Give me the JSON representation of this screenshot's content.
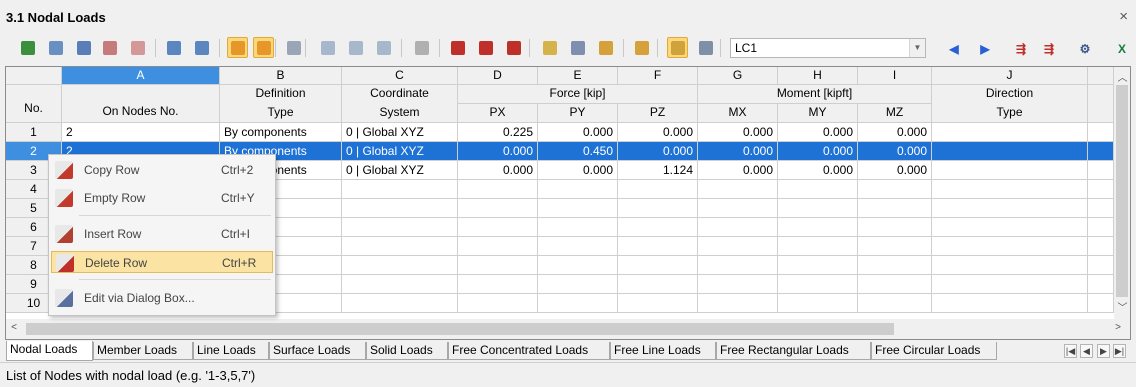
{
  "window": {
    "title": "3.1 Nodal Loads",
    "close_glyph": "×"
  },
  "toolbar": {
    "buttons": [
      {
        "name": "select-icon",
        "color": "#3c8f3c"
      },
      {
        "name": "insert-icon",
        "color": "#6a8fc2"
      },
      {
        "name": "filter-icon",
        "color": "#5a7fb8"
      },
      {
        "name": "graphics-icon",
        "color": "#c77a7a"
      },
      {
        "name": "diagram-icon",
        "color": "#d59898"
      },
      {
        "name": "import-icon",
        "color": "#5b86c0"
      },
      {
        "name": "export-icon",
        "color": "#5b86c0"
      },
      {
        "name": "undo-icon",
        "color": "#e7962a"
      },
      {
        "name": "redo-icon",
        "color": "#e7962a"
      },
      {
        "name": "refresh-icon",
        "color": "#9aa6b8"
      },
      {
        "name": "view-icon",
        "color": "#a8b8cc"
      },
      {
        "name": "copy-icon",
        "color": "#a8b8cc"
      },
      {
        "name": "paste-icon",
        "color": "#a8b8cc"
      },
      {
        "name": "clear-icon",
        "color": "#b0b0b0"
      },
      {
        "name": "delete-column-icon",
        "color": "#c0302b"
      },
      {
        "name": "insert-column-icon",
        "color": "#c0302b"
      },
      {
        "name": "delete-column-right-icon",
        "color": "#c0302b"
      },
      {
        "name": "table-icon",
        "color": "#d6b34a"
      },
      {
        "name": "table-view-icon",
        "color": "#7f8fb0"
      },
      {
        "name": "edit-icon",
        "color": "#d6a13a"
      },
      {
        "name": "load-icon",
        "color": "#d6a13a"
      },
      {
        "name": "select-tool-icon",
        "color": "#cfa23c"
      },
      {
        "name": "settings-icon",
        "color": "#7e8fa8"
      }
    ],
    "load_case": "LC1",
    "right_buttons": [
      {
        "name": "prev-icon",
        "glyph": "◀",
        "color": "#2a5fd6"
      },
      {
        "name": "next-icon",
        "glyph": "▶",
        "color": "#2a5fd6"
      },
      {
        "name": "export-table-icon",
        "glyph": "⇶",
        "color": "#c0302b"
      },
      {
        "name": "import-table-icon",
        "glyph": "⇶",
        "color": "#c0302b"
      },
      {
        "name": "tools-icon",
        "glyph": "⚙",
        "color": "#3a5a8a"
      },
      {
        "name": "excel-icon",
        "glyph": "X",
        "color": "#1e7a3c"
      }
    ]
  },
  "grid": {
    "row_header_label": "No.",
    "column_letters": [
      "A",
      "B",
      "C",
      "D",
      "E",
      "F",
      "G",
      "H",
      "I",
      "J"
    ],
    "header_row1": {
      "definition": "Definition",
      "coordinate": "Coordinate",
      "force": "Force [kip]",
      "moment": "Moment [kipft]",
      "direction": "Direction"
    },
    "header_row2": {
      "nodes": "On Nodes No.",
      "type": "Type",
      "system": "System",
      "px": "PX",
      "py": "PY",
      "pz": "PZ",
      "mx": "MX",
      "my": "MY",
      "mz": "MZ",
      "dir_type": "Type"
    },
    "rows": [
      {
        "no": "1",
        "nodes": "2",
        "type": "By components",
        "system": "0  |  Global XYZ",
        "px": "0.225",
        "py": "0.000",
        "pz": "0.000",
        "mx": "0.000",
        "my": "0.000",
        "mz": "0.000"
      },
      {
        "no": "2",
        "nodes": "2",
        "type": "By components",
        "system": "0  |  Global XYZ",
        "px": "0.000",
        "py": "0.450",
        "pz": "0.000",
        "mx": "0.000",
        "my": "0.000",
        "mz": "0.000"
      },
      {
        "no": "3",
        "nodes": "",
        "type": "By components",
        "system": "0  |  Global XYZ",
        "px": "0.000",
        "py": "0.000",
        "pz": "1.124",
        "mx": "0.000",
        "my": "0.000",
        "mz": "0.000"
      },
      {
        "no": "4"
      },
      {
        "no": "5"
      },
      {
        "no": "6"
      },
      {
        "no": "7"
      },
      {
        "no": "8"
      },
      {
        "no": "9"
      },
      {
        "no": "10"
      }
    ],
    "selected_row": 2
  },
  "context_menu": {
    "items": [
      {
        "label": "Copy Row",
        "shortcut": "Ctrl+2",
        "icon": "copy-row-icon"
      },
      {
        "label": "Empty Row",
        "shortcut": "Ctrl+Y",
        "icon": "empty-row-icon"
      },
      {
        "label": "Insert Row",
        "shortcut": "Ctrl+I",
        "icon": "insert-row-icon"
      },
      {
        "label": "Delete Row",
        "shortcut": "Ctrl+R",
        "icon": "delete-row-icon"
      },
      {
        "label": "Edit via Dialog Box...",
        "shortcut": "",
        "icon": "edit-dialog-icon"
      }
    ],
    "highlighted": "Delete Row"
  },
  "tabs": [
    "Nodal Loads",
    "Member Loads",
    "Line Loads",
    "Surface Loads",
    "Solid Loads",
    "Free Concentrated Loads",
    "Free Line Loads",
    "Free Rectangular Loads",
    "Free Circular Loads"
  ],
  "active_tab": "Nodal Loads",
  "tab_nav": [
    "|◀",
    "◀",
    "▶",
    "▶|"
  ],
  "status": "List of Nodes with nodal load (e.g. '1-3,5,7')",
  "colors": {
    "selection": "#1e72d6",
    "column_highlight": "#3f8fe1",
    "menu_highlight": "#fbe3a3"
  }
}
